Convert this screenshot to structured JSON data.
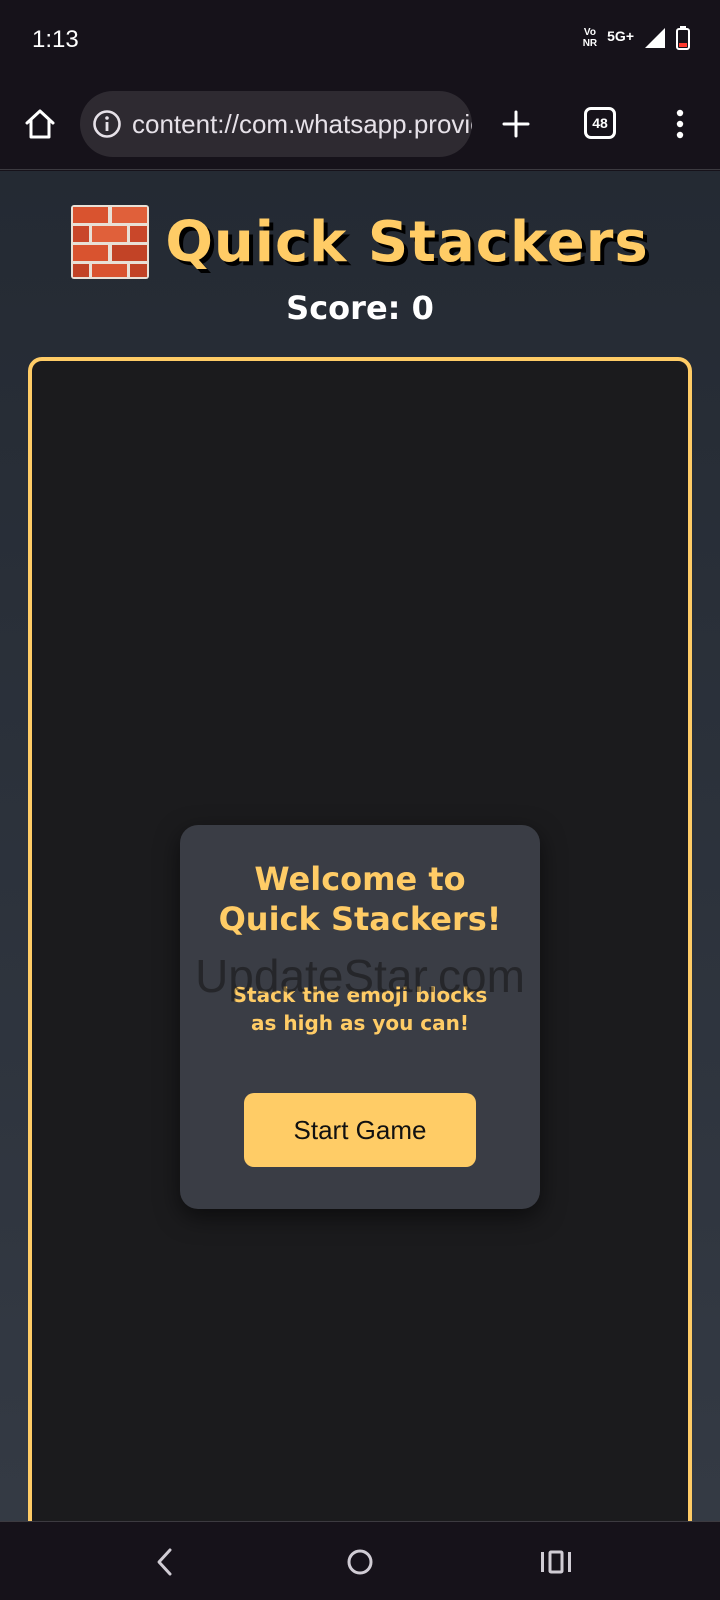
{
  "status_bar": {
    "time": "1:13",
    "volte_line1": "Vo",
    "volte_line2": "NR",
    "network": "5G+"
  },
  "browser": {
    "url": "content://com.whatsapp.provider.media/item/",
    "tab_count": "48",
    "icons": [
      "home-icon",
      "info-icon",
      "plus-icon",
      "tabs-icon",
      "more-vert-icon"
    ]
  },
  "game": {
    "title_emoji": "brick-icon",
    "title": "Quick Stackers",
    "score_label": "Score: 0",
    "modal": {
      "title": "Welcome to Quick Stackers!",
      "text": "Stack the emoji blocks as high as you can!",
      "start_button": "Start Game"
    },
    "colors": {
      "accent": "#ffcc66",
      "board": "#1b1b1d",
      "modal": "#3a3d45"
    }
  },
  "watermark": "UpdateStar.com",
  "nav": {
    "icons": [
      "back-icon",
      "home-circle-icon",
      "recents-icon"
    ]
  }
}
